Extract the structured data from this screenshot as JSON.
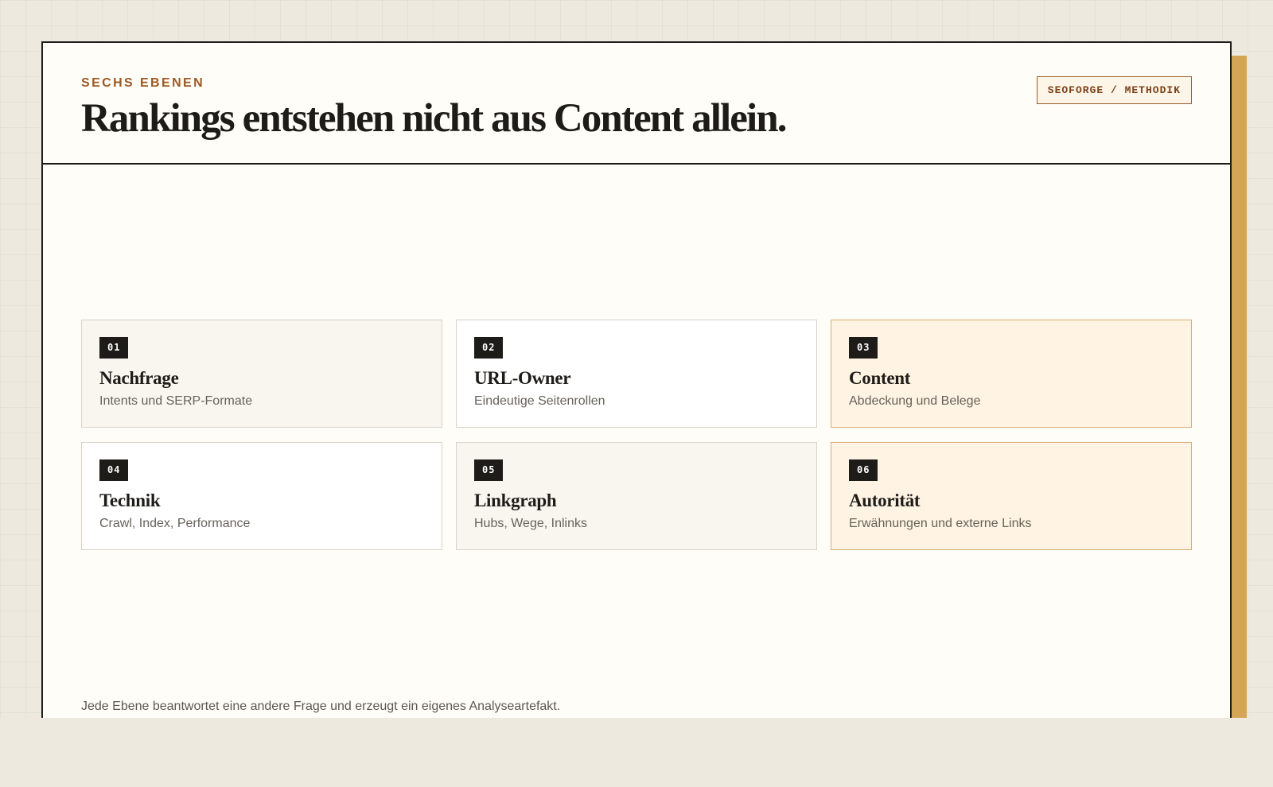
{
  "header": {
    "eyebrow": "SECHS EBENEN",
    "title": "Rankings entstehen nicht aus Content allein.",
    "tag": "SEOFORGE / METHODIK"
  },
  "layers": [
    {
      "number": "01",
      "title": "Nachfrage",
      "subtitle": "Intents und SERP-Formate",
      "tone": "muted"
    },
    {
      "number": "02",
      "title": "URL-Owner",
      "subtitle": "Eindeutige Seitenrollen",
      "tone": "plain"
    },
    {
      "number": "03",
      "title": "Content",
      "subtitle": "Abdeckung und Belege",
      "tone": "accent"
    },
    {
      "number": "04",
      "title": "Technik",
      "subtitle": "Crawl, Index, Performance",
      "tone": "plain"
    },
    {
      "number": "05",
      "title": "Linkgraph",
      "subtitle": "Hubs, Wege, Inlinks",
      "tone": "muted"
    },
    {
      "number": "06",
      "title": "Autorität",
      "subtitle": "Erwähnungen und externe Links",
      "tone": "accent"
    }
  ],
  "footer": {
    "note": "Jede Ebene beantwortet eine andere Frage und erzeugt ein eigenes Analyseartefakt."
  },
  "colors": {
    "background": "#ede9df",
    "panel": "#fffdf8",
    "ink": "#1e1c19",
    "accent": "#9c5a26",
    "shadow_bar": "#d4a555",
    "accent_card": "#fff4e3",
    "muted_card": "#f9f6f0"
  }
}
